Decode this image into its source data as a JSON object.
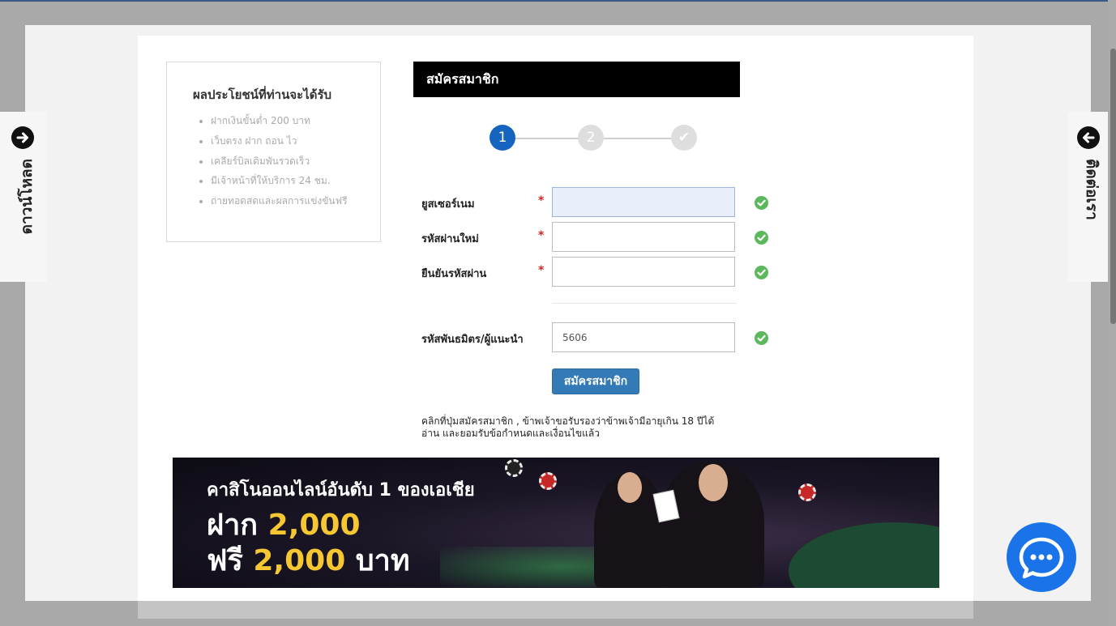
{
  "benefits": {
    "title": "ผลประโยชน์ที่ท่านจะได้รับ",
    "items": [
      "ฝากเงินขั้นต่ำ 200 บาท",
      "เว็บตรง ฝาก ถอน ไว",
      "เคลียร์บิลเดิมพันรวดเร็ว",
      "มีเจ้าหน้าที่ให้บริการ 24 ชม.",
      "ถ่ายทอดสดและผลการแข่งขันฟรี"
    ]
  },
  "form": {
    "header": "สมัครสมาชิก",
    "steps": [
      "1",
      "2",
      "✔"
    ],
    "current_step": 1,
    "fields": [
      {
        "label": "ยูสเซอร์เนม",
        "required": "*",
        "value": ""
      },
      {
        "label": "รหัสผ่านใหม่",
        "required": "*",
        "value": ""
      },
      {
        "label": "ยืนยันรหัสผ่าน",
        "required": "*",
        "value": ""
      },
      {
        "label": "รหัสพันธมิตร/ผู้แนะนำ",
        "required": "",
        "value": "5606"
      }
    ],
    "submit_label": "สมัครสมาชิก",
    "terms_line1": "คลิกที่ปุ่มสมัครสมาชิก , ข้าพเจ้าขอรับรองว่าข้าพเจ้ามีอายุเกิน 18 ปีได้",
    "terms_line2": "อ่าน และยอมรับข้อกำหนดและเงื่อนไขแล้ว"
  },
  "banner": {
    "line1": "คาสิโนออนไลน์อันดับ 1 ของเอเชีย",
    "line2_prefix": "ฝาก",
    "line2_amount": "2,000",
    "line3_prefix": "ฟรี",
    "line3_amount": "2,000",
    "line3_suffix": "บาท"
  },
  "side_tabs": {
    "left_label": "ดาวน์โหลด",
    "right_label": "ติดต่อเรา"
  },
  "colors": {
    "header_bg": "#000000",
    "step_active": "#1565c0",
    "submit_bg": "#337ab7",
    "check_green": "#5cb85c",
    "required_red": "#e02020",
    "chat_blue": "#1a73e8",
    "banner_gold": "#f6c733"
  },
  "icons": {
    "left_tab": "arrow-right-circle-icon",
    "right_tab": "arrow-left-circle-icon",
    "field_status": "check-circle-icon",
    "chat": "chat-bubble-icon"
  }
}
